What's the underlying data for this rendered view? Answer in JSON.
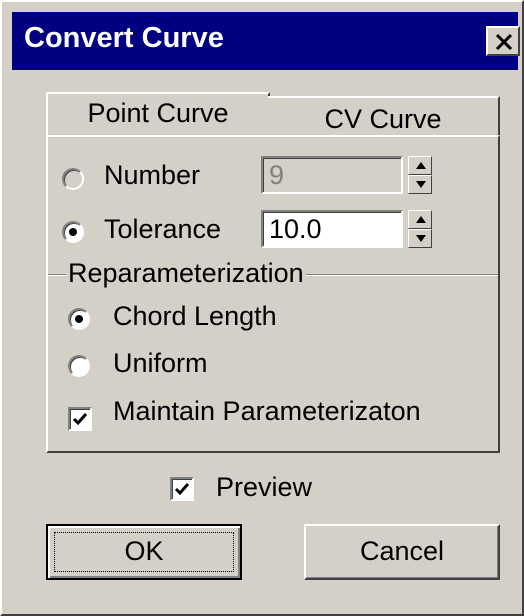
{
  "window": {
    "title": "Convert Curve",
    "close_icon": "close-icon"
  },
  "tabs": [
    {
      "label": "Point Curve",
      "selected": false
    },
    {
      "label": "CV Curve",
      "selected": true
    }
  ],
  "options": {
    "number": {
      "label": "Number",
      "value": "9",
      "selected": false,
      "enabled": false
    },
    "tolerance": {
      "label": "Tolerance",
      "value": "10.0",
      "selected": true,
      "enabled": true
    }
  },
  "reparameterization": {
    "group_label": "Reparameterization",
    "chord_length_label": "Chord Length",
    "uniform_label": "Uniform",
    "selected": "Chord Length",
    "maintain_label": "Maintain Parameterizaton",
    "maintain_checked": true
  },
  "preview": {
    "label": "Preview",
    "checked": true
  },
  "buttons": {
    "ok_label": "OK",
    "cancel_label": "Cancel"
  },
  "colors": {
    "titlebar": "#000080",
    "face": "#d4d0c8"
  }
}
